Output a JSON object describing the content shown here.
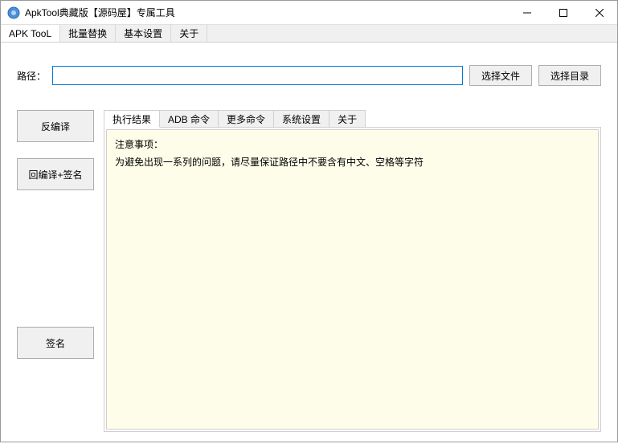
{
  "window": {
    "title": "ApkTool典藏版【源码屋】专属工具"
  },
  "menubar": {
    "items": [
      {
        "label": "APK TooL"
      },
      {
        "label": "批量替换"
      },
      {
        "label": "基本设置"
      },
      {
        "label": "关于"
      }
    ]
  },
  "path": {
    "label": "路径：",
    "value": "",
    "select_file": "选择文件",
    "select_dir": "选择目录"
  },
  "actions": {
    "decompile": "反编译",
    "recompile_sign": "回编译+签名",
    "sign": "签名"
  },
  "tabs": {
    "items": [
      {
        "label": "执行结果"
      },
      {
        "label": "ADB 命令"
      },
      {
        "label": "更多命令"
      },
      {
        "label": "系统设置"
      },
      {
        "label": "关于"
      }
    ]
  },
  "result": {
    "line1": "注意事项：",
    "line2": "为避免出现一系列的问题，请尽量保证路径中不要含有中文、空格等字符"
  }
}
